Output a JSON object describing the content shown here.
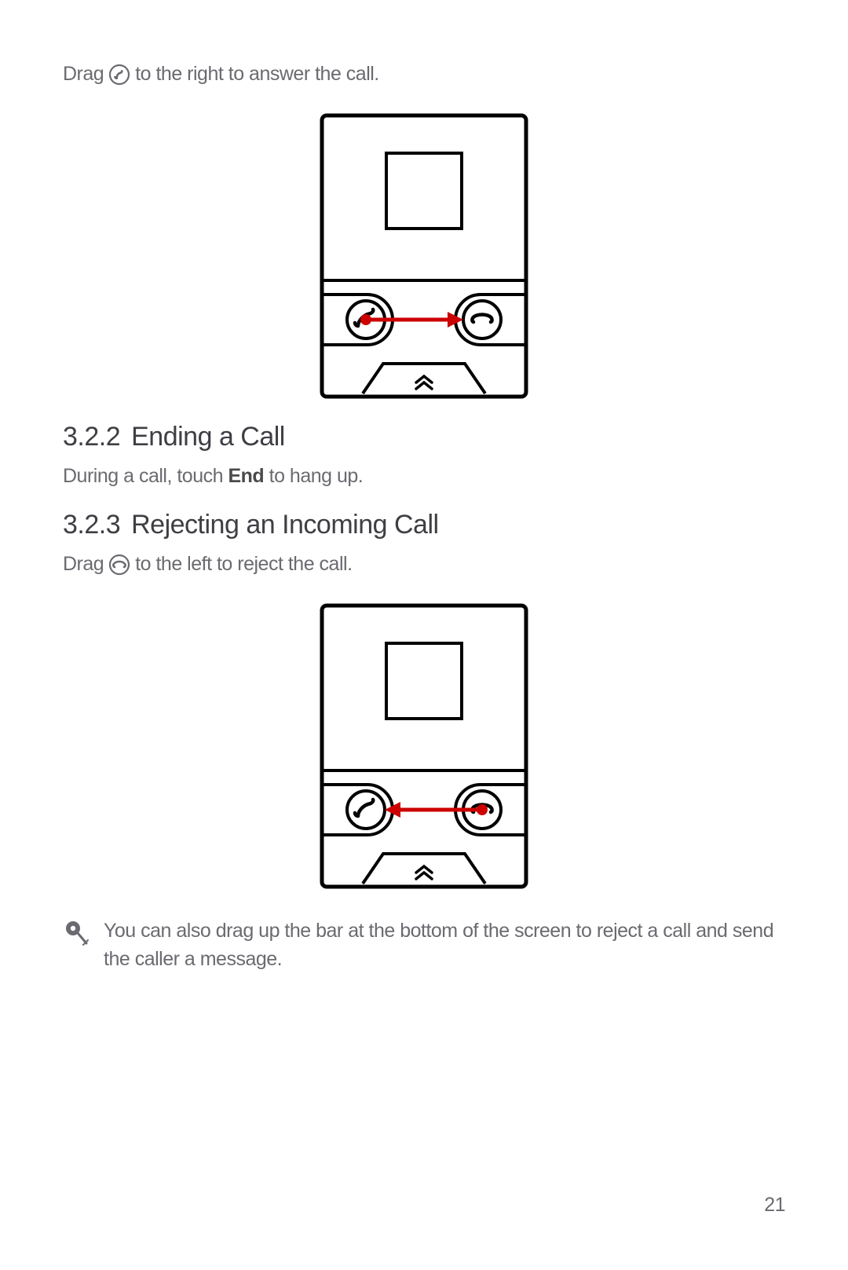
{
  "instr1_pre": "Drag",
  "instr1_post": "to the right to answer the call.",
  "heading_322_num": "3.2.2",
  "heading_322_title": "Ending a Call",
  "ending_text_pre": "During a call, touch ",
  "ending_text_bold": "End",
  "ending_text_post": " to hang up.",
  "heading_323_num": "3.2.3",
  "heading_323_title": "Rejecting an Incoming Call",
  "instr2_pre": "Drag",
  "instr2_post": "to the left to reject the call.",
  "tip_text": "You can also drag up the bar at the bottom of the screen to reject a call and send the caller a message.",
  "page_number": "21"
}
